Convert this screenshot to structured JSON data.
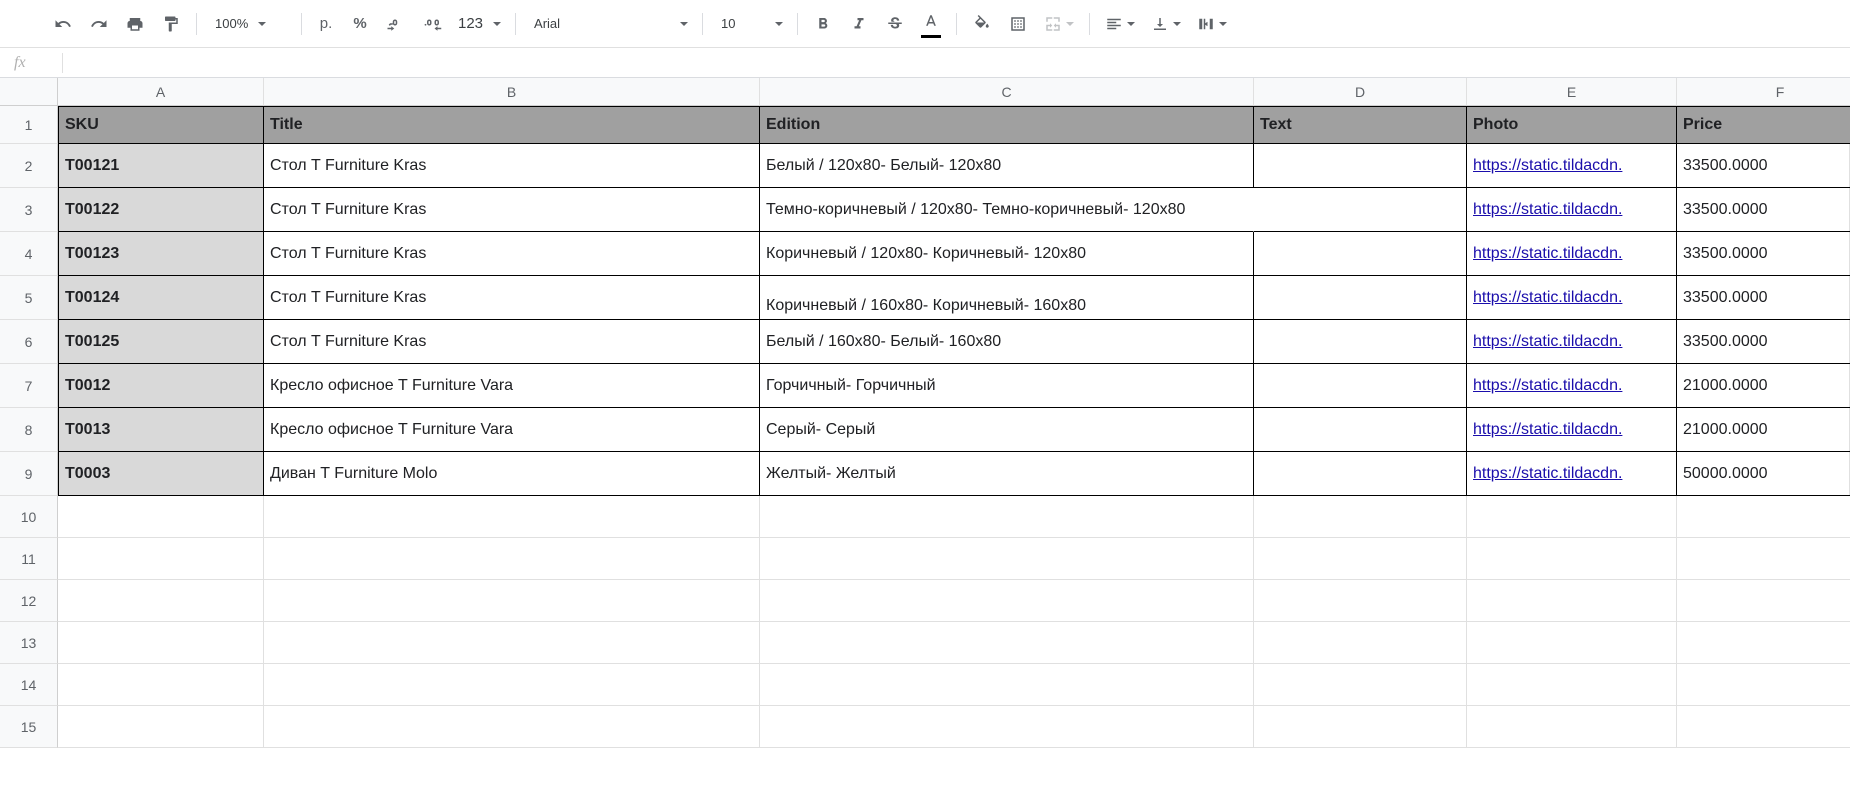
{
  "toolbar": {
    "zoom": "100%",
    "currency_label": "р.",
    "percent_label": "%",
    "dec_dec_label": ".0",
    "inc_dec_label": ".00",
    "more_formats_label": "123",
    "font": "Arial",
    "font_size": "10"
  },
  "formula_bar": {
    "fx_label": "fx",
    "value": ""
  },
  "columns": [
    "A",
    "B",
    "C",
    "D",
    "E",
    "F"
  ],
  "row_numbers": [
    "1",
    "2",
    "3",
    "4",
    "5",
    "6",
    "7",
    "8",
    "9",
    "10",
    "11",
    "12",
    "13",
    "14",
    "15"
  ],
  "headers": {
    "sku": "SKU",
    "title": "Title",
    "edition": "Edition",
    "text": "Text",
    "photo": "Photo",
    "price": "Price"
  },
  "chart_data": {
    "type": "table",
    "columns": [
      "SKU",
      "Title",
      "Edition",
      "Text",
      "Photo",
      "Price"
    ],
    "rows": [
      {
        "sku": "T00121",
        "title": "Стол T Furniture Kras",
        "edition": "Белый / 120х80- Белый- 120х80",
        "text": "",
        "photo": "https://static.tildacdn.",
        "price": "33500.0000"
      },
      {
        "sku": "T00122",
        "title": "Стол T Furniture Kras",
        "edition": "Темно-коричневый / 120х80- Темно-коричневый- 120х80",
        "text": "",
        "photo": "https://static.tildacdn.",
        "price": "33500.0000"
      },
      {
        "sku": "T00123",
        "title": "Стол T Furniture Kras",
        "edition": "Коричневый / 120х80- Коричневый- 120х80",
        "text": "",
        "photo": "https://static.tildacdn.",
        "price": "33500.0000"
      },
      {
        "sku": "T00124",
        "title": "Стол T Furniture Kras",
        "edition": "Коричневый / 160х80- Коричневый- 160х80",
        "text": "",
        "photo": "https://static.tildacdn.",
        "price": "33500.0000"
      },
      {
        "sku": "T00125",
        "title": "Стол T Furniture Kras",
        "edition": "Белый / 160х80- Белый- 160х80",
        "text": "",
        "photo": "https://static.tildacdn.",
        "price": "33500.0000"
      },
      {
        "sku": "T0012",
        "title": "Кресло офисное T Furniture Vara",
        "edition": "Горчичный- Горчичный",
        "text": "",
        "photo": "https://static.tildacdn.",
        "price": "21000.0000"
      },
      {
        "sku": "T0013",
        "title": "Кресло офисное T Furniture Vara",
        "edition": "Серый- Серый",
        "text": "",
        "photo": "https://static.tildacdn.",
        "price": "21000.0000"
      },
      {
        "sku": "T0003",
        "title": "Диван T Furniture Molo",
        "edition": "Желтый- Желтый",
        "text": "",
        "photo": "https://static.tildacdn.",
        "price": "50000.0000"
      }
    ]
  }
}
